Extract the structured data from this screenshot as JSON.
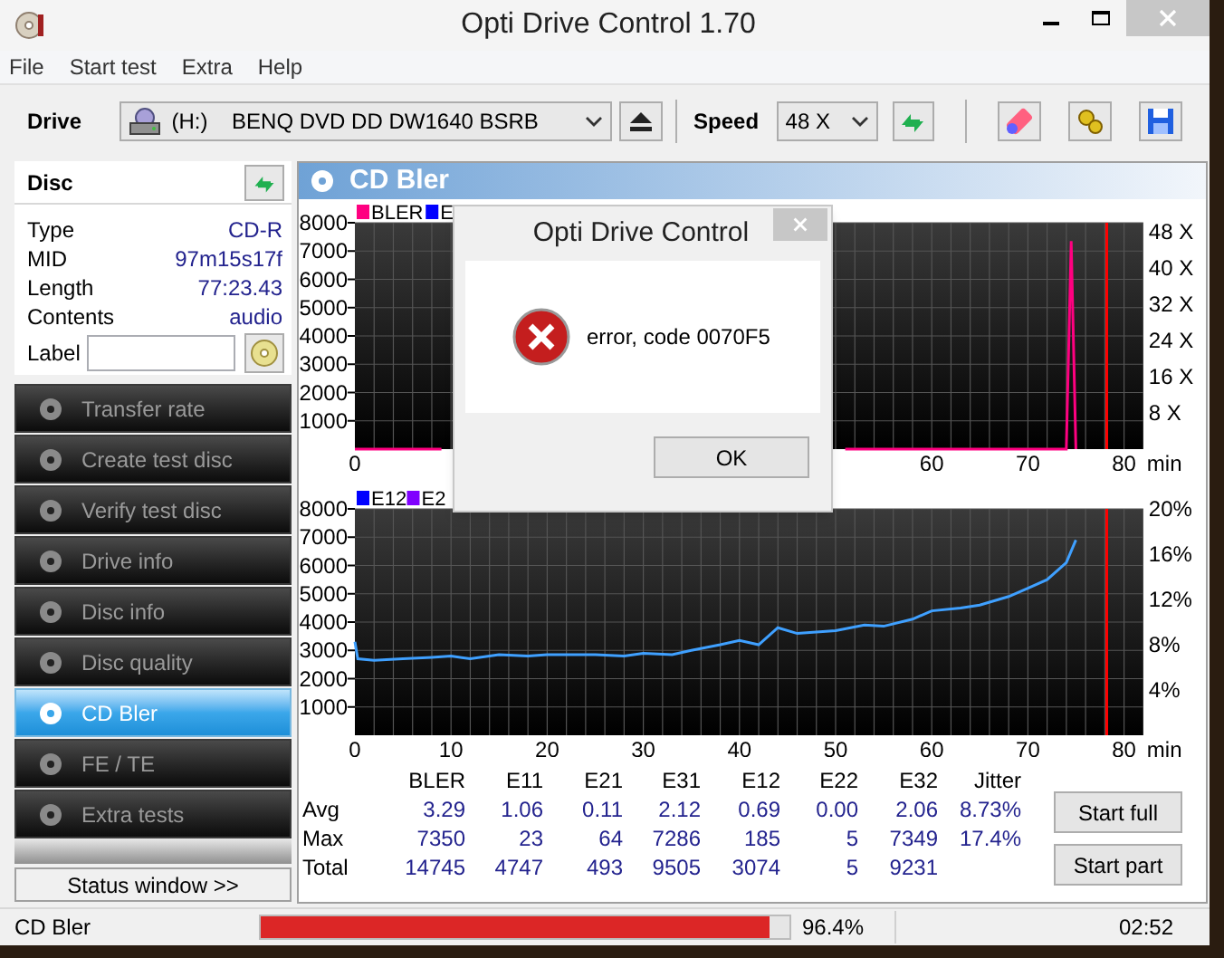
{
  "window": {
    "title": "Opti Drive Control 1.70"
  },
  "menu": [
    "File",
    "Start test",
    "Extra",
    "Help"
  ],
  "toolbar": {
    "drive_label": "Drive",
    "drive": "(H:)    BENQ DVD DD DW1640 BSRB",
    "speed_label": "Speed",
    "speed": "48 X"
  },
  "disc": {
    "title": "Disc",
    "fields": [
      {
        "label": "Type",
        "value": "CD-R"
      },
      {
        "label": "MID",
        "value": "97m15s17f"
      },
      {
        "label": "Length",
        "value": "77:23.43"
      },
      {
        "label": "Contents",
        "value": "audio"
      }
    ],
    "label_field": {
      "label": "Label"
    }
  },
  "nav": [
    {
      "label": "Transfer rate",
      "selected": false
    },
    {
      "label": "Create test disc",
      "selected": false
    },
    {
      "label": "Verify test disc",
      "selected": false
    },
    {
      "label": "Drive info",
      "selected": false
    },
    {
      "label": "Disc info",
      "selected": false
    },
    {
      "label": "Disc quality",
      "selected": false
    },
    {
      "label": "CD Bler",
      "selected": true
    },
    {
      "label": "FE / TE",
      "selected": false
    },
    {
      "label": "Extra tests",
      "selected": false
    }
  ],
  "status_window_button": "Status window >>",
  "panel": {
    "title": "CD Bler"
  },
  "charts": [
    {
      "legend": [
        {
          "label": "E",
          "color": "#0000ff"
        }
      ],
      "right_axis_labels": [
        "48 X",
        "40 X",
        "32 X",
        "24 X",
        "16 X",
        "8 X"
      ],
      "chart_data": {
        "type": "line",
        "grid": true,
        "xlabel": "min",
        "x": [
          0,
          5,
          9,
          51,
          60,
          70,
          74,
          74.5,
          75
        ],
        "series": [
          {
            "name": "BLER",
            "color": "#ff0080",
            "values": [
              0,
              0,
              0,
              0,
              0,
              0,
              0,
              7350,
              0
            ]
          }
        ],
        "xlim": [
          0,
          82
        ],
        "ylim": [
          0,
          8000
        ],
        "xticks": [
          0,
          60,
          70,
          80
        ],
        "yticks": [
          1000,
          2000,
          3000,
          4000,
          5000,
          6000,
          7000,
          8000
        ],
        "ref_lines": [
          {
            "axis": "x",
            "value": 78.2
          }
        ]
      }
    },
    {
      "legend": [
        {
          "label": "E12",
          "color": "#0000ff"
        },
        {
          "label": "E2",
          "color": "#8000ff"
        }
      ],
      "right_axis_labels": [
        "20%",
        "16%",
        "12%",
        "8%",
        "4%"
      ],
      "chart_data": {
        "type": "line",
        "grid": true,
        "xlabel": "min",
        "x": [
          0,
          0.3,
          2,
          5,
          8,
          10,
          12,
          15,
          18,
          20,
          25,
          28,
          30,
          33,
          35,
          38,
          40,
          42,
          44,
          46,
          50,
          53,
          55,
          58,
          60,
          63,
          65,
          68,
          70,
          72,
          74,
          75
        ],
        "series": [
          {
            "color": "#3fa0ff",
            "values": [
              3300,
              2700,
              2650,
              2700,
              2750,
              2800,
              2700,
              2850,
              2800,
              2850,
              2850,
              2800,
              2900,
              2850,
              3000,
              3200,
              3350,
              3200,
              3800,
              3600,
              3700,
              3900,
              3850,
              4100,
              4400,
              4500,
              4600,
              4900,
              5200,
              5500,
              6100,
              6900
            ]
          }
        ],
        "xlim": [
          0,
          82
        ],
        "ylim": [
          0,
          8000
        ],
        "xticks": [
          0,
          10,
          20,
          30,
          40,
          50,
          60,
          70,
          80
        ],
        "yticks": [
          1000,
          2000,
          3000,
          4000,
          5000,
          6000,
          7000,
          8000
        ],
        "ref_lines": [
          {
            "axis": "x",
            "value": 78.2
          }
        ]
      }
    }
  ],
  "stats": {
    "columns": [
      "BLER",
      "E11",
      "E21",
      "E31",
      "E12",
      "E22",
      "E32",
      "Jitter"
    ],
    "rows": [
      {
        "label": "Avg",
        "cells": [
          "3.29",
          "1.06",
          "0.11",
          "2.12",
          "0.69",
          "0.00",
          "2.06",
          "8.73%"
        ]
      },
      {
        "label": "Max",
        "cells": [
          "7350",
          "23",
          "64",
          "7286",
          "185",
          "5",
          "7349",
          "17.4%"
        ]
      },
      {
        "label": "Total",
        "cells": [
          "14745",
          "4747",
          "493",
          "9505",
          "3074",
          "5",
          "9231"
        ]
      }
    ]
  },
  "buttons": [
    "Start full",
    "Start part"
  ],
  "status_bar": {
    "text": "CD Bler",
    "level": 0.964,
    "percent": "96.4%",
    "time": "02:52"
  },
  "dialog": {
    "title": "Opti Drive Control",
    "message": "error, code 0070F5",
    "button": "OK"
  }
}
